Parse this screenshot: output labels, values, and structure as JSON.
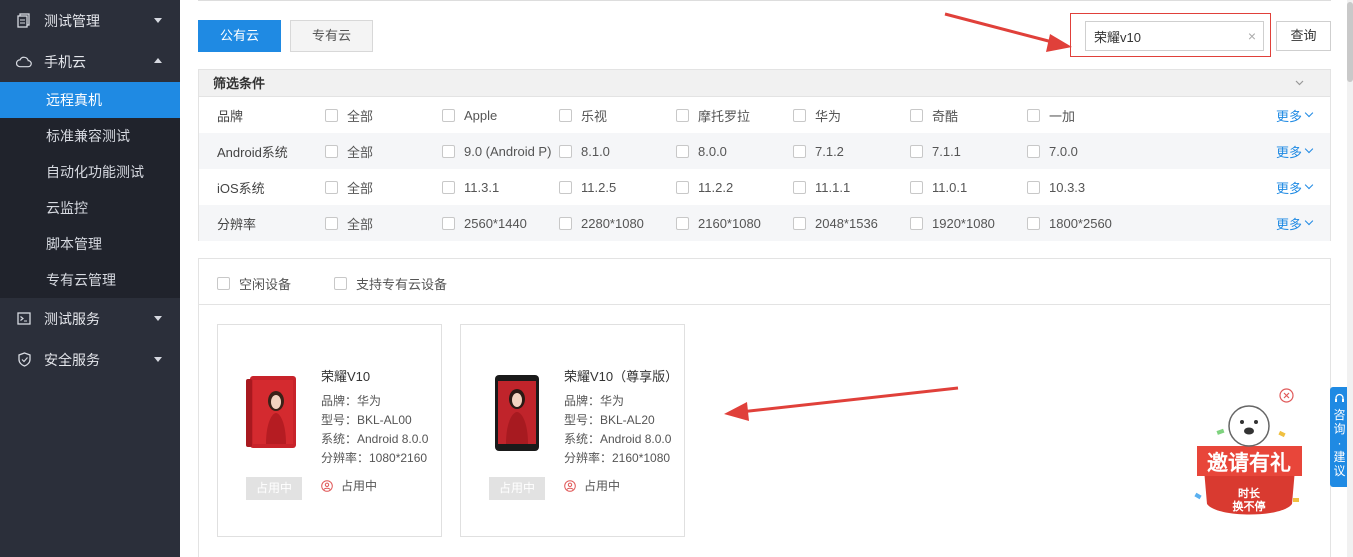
{
  "sidebar": {
    "groups": [
      {
        "label": "测试管理",
        "icon": "document-icon"
      },
      {
        "label": "手机云",
        "icon": "cloud-icon"
      },
      {
        "label": "测试服务",
        "icon": "terminal-icon"
      },
      {
        "label": "安全服务",
        "icon": "shield-icon"
      }
    ],
    "sub_items": [
      "远程真机",
      "标准兼容测试",
      "自动化功能测试",
      "云监控",
      "脚本管理",
      "专有云管理"
    ],
    "active_item": "远程真机"
  },
  "tabs": {
    "public": "公有云",
    "private": "专有云"
  },
  "search": {
    "value": "荣耀v10",
    "clear": "×",
    "button": "查询"
  },
  "filter": {
    "title": "筛选条件",
    "more_label": "更多",
    "rows": [
      {
        "label": "品牌",
        "options": [
          "全部",
          "Apple",
          "乐视",
          "摩托罗拉",
          "华为",
          "奇酷",
          "一加"
        ]
      },
      {
        "label": "Android系统",
        "options": [
          "全部",
          "9.0 (Android P)",
          "8.1.0",
          "8.0.0",
          "7.1.2",
          "7.1.1",
          "7.0.0"
        ]
      },
      {
        "label": "iOS系统",
        "options": [
          "全部",
          "11.3.1",
          "11.2.5",
          "11.2.2",
          "11.1.1",
          "11.0.1",
          "10.3.3"
        ]
      },
      {
        "label": "分辨率",
        "options": [
          "全部",
          "2560*1440",
          "2280*1080",
          "2160*1080",
          "2048*1536",
          "1920*1080",
          "1800*2560"
        ]
      }
    ]
  },
  "device_filters": {
    "idle": "空闲设备",
    "private_support": "支持专有云设备"
  },
  "devices": [
    {
      "name": "荣耀V10",
      "brand": "品牌：华为",
      "model": "型号：BKL-AL00",
      "os": "系统：Android 8.0.0",
      "resolution": "分辨率：1080*2160",
      "button": "占用中",
      "status": "占用中",
      "phone_color": "#c8232a"
    },
    {
      "name": "荣耀V10（尊享版）",
      "brand": "品牌：华为",
      "model": "型号：BKL-AL20",
      "os": "系统：Android 8.0.0",
      "resolution": "分辨率：2160*1080",
      "button": "占用中",
      "status": "占用中",
      "phone_color": "#1a1a1a"
    }
  ],
  "widgets": {
    "consult": "咨询·建议",
    "invite_title": "邀请有礼",
    "invite_sub": "时长\n换不停"
  },
  "colors": {
    "accent": "#1f8ae3",
    "sidebar_bg": "#2b2f3a",
    "annotation_red": "#e0403a"
  }
}
